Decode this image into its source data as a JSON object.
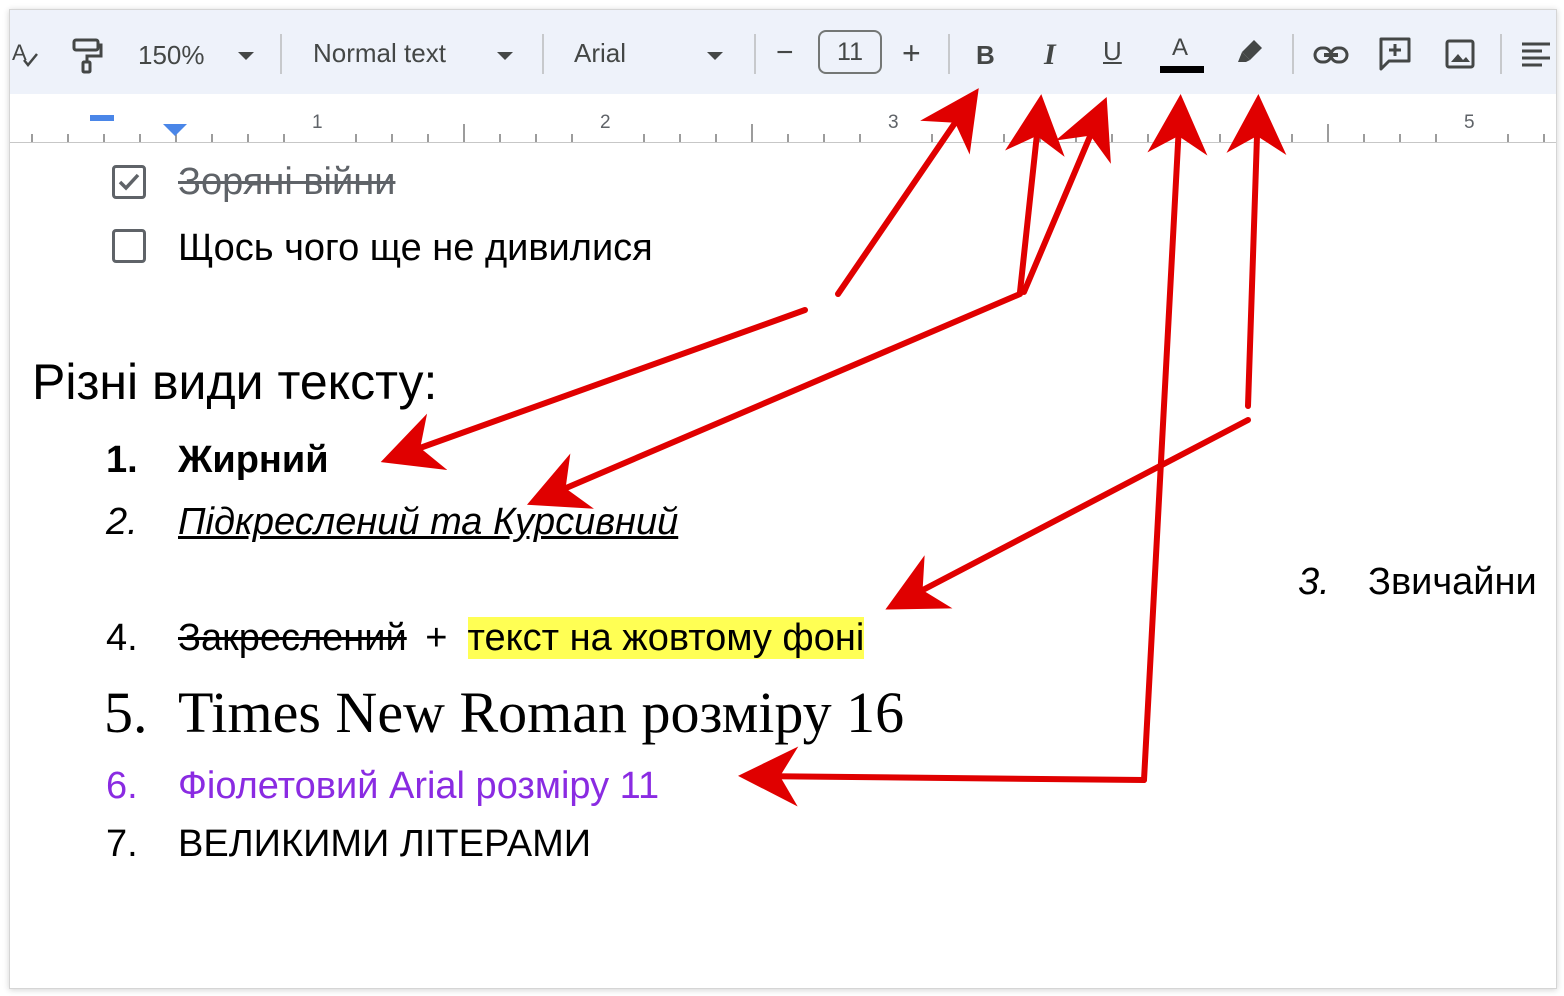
{
  "toolbar": {
    "zoom": "150%",
    "style": "Normal text",
    "font": "Arial",
    "font_size": "11",
    "minus": "−",
    "plus": "+",
    "bold": "B",
    "italic": "I",
    "underline": "U",
    "text_color": "A"
  },
  "ruler": {
    "marks": [
      "1",
      "2",
      "3",
      "5"
    ]
  },
  "checklist": [
    {
      "label": "Зоряні війни",
      "checked": true
    },
    {
      "label": "Щось чого ще не дивилися",
      "checked": false
    }
  ],
  "heading": "Різні види тексту:",
  "list": [
    {
      "num": "1.",
      "text": "Жирний"
    },
    {
      "num": "2.",
      "text": "Підкреслений та Курсивний"
    },
    {
      "num": "3.",
      "text": "Звичайни"
    },
    {
      "num": "4.",
      "text_strike": "Закреслений",
      "text_plus": "+",
      "text_highlight": "текст на жовтому фоні"
    },
    {
      "num": "5.",
      "text": "Times New Roman розміру 16"
    },
    {
      "num": "6.",
      "text": "Фіолетовий Arial розміру 11"
    },
    {
      "num": "7.",
      "text": "ВЕЛИКИМИ ЛІТЕРАМИ"
    }
  ],
  "colors": {
    "toolbar_bg": "#eef2fa",
    "purple_text": "#8a2be2",
    "highlight": "#ffff54",
    "arrow": "#e00000",
    "ruler_indent": "#4a86e8"
  }
}
